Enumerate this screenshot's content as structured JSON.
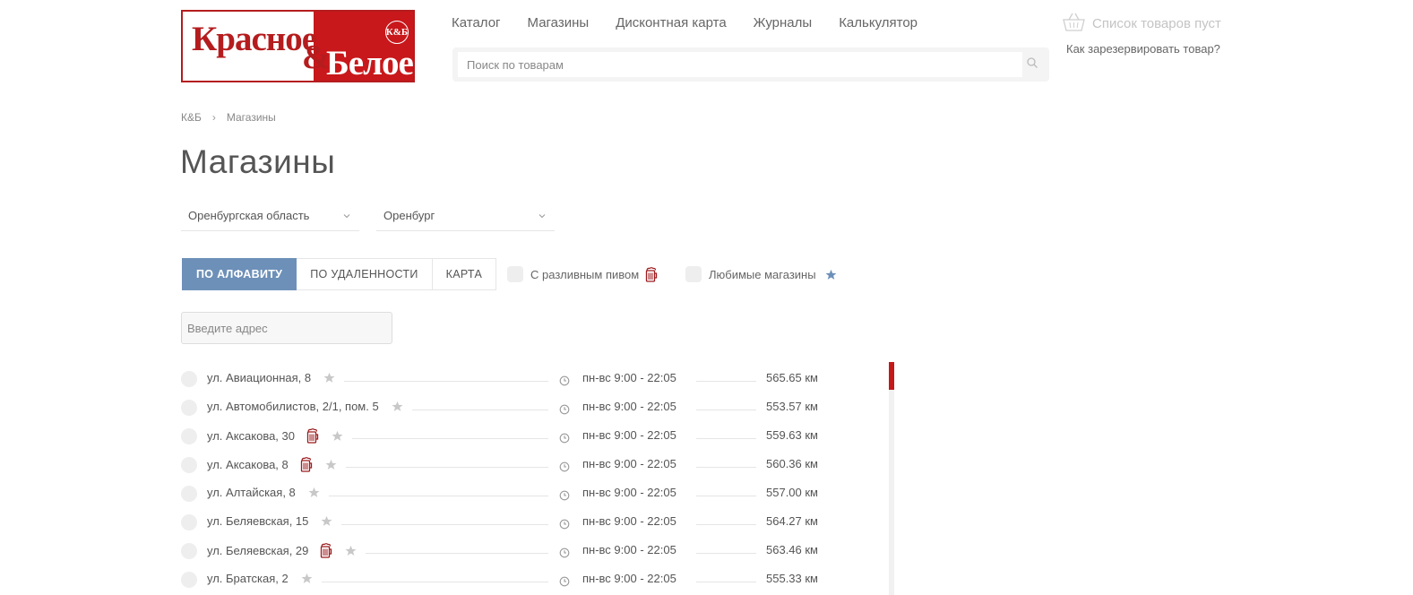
{
  "logo": {
    "word1": "Красное",
    "amp": "&",
    "word2": "Белое",
    "badge": "К&Б"
  },
  "nav": [
    "Каталог",
    "Магазины",
    "Дисконтная карта",
    "Журналы",
    "Калькулятор"
  ],
  "search": {
    "placeholder": "Поиск по товарам"
  },
  "cart": {
    "label": "Список товаров пуст",
    "reserve_link": "Как зарезервировать товар?"
  },
  "breadcrumb": {
    "home": "К&Б",
    "current": "Магазины"
  },
  "page_title": "Магазины",
  "filters": {
    "region": "Оренбургская область",
    "city": "Оренбург"
  },
  "tabs": [
    "ПО АЛФАВИТУ",
    "ПО УДАЛЕННОСТИ",
    "КАРТА"
  ],
  "checkboxes": {
    "draft_beer": "С разливным пивом",
    "favorites": "Любимые магазины"
  },
  "address_input": {
    "placeholder": "Введите адрес"
  },
  "colors": {
    "brand_red": "#c8181b",
    "accent_blue": "#6d90b8"
  },
  "stores": [
    {
      "address": "ул. Авиационная, 8",
      "beer": false,
      "hours": "пн-вс 9:00 - 22:05",
      "distance": "565.65 км"
    },
    {
      "address": "ул. Автомобилистов, 2/1, пом. 5",
      "beer": false,
      "hours": "пн-вс 9:00 - 22:05",
      "distance": "553.57 км"
    },
    {
      "address": "ул. Аксакова, 30",
      "beer": true,
      "hours": "пн-вс 9:00 - 22:05",
      "distance": "559.63 км"
    },
    {
      "address": "ул. Аксакова, 8",
      "beer": true,
      "hours": "пн-вс 9:00 - 22:05",
      "distance": "560.36 км"
    },
    {
      "address": "ул. Алтайская, 8",
      "beer": false,
      "hours": "пн-вс 9:00 - 22:05",
      "distance": "557.00 км"
    },
    {
      "address": "ул. Беляевская, 15",
      "beer": false,
      "hours": "пн-вс 9:00 - 22:05",
      "distance": "564.27 км"
    },
    {
      "address": "ул. Беляевская, 29",
      "beer": true,
      "hours": "пн-вс 9:00 - 22:05",
      "distance": "563.46 км"
    },
    {
      "address": "ул. Братская, 2",
      "beer": false,
      "hours": "пн-вс 9:00 - 22:05",
      "distance": "555.33 км"
    }
  ]
}
